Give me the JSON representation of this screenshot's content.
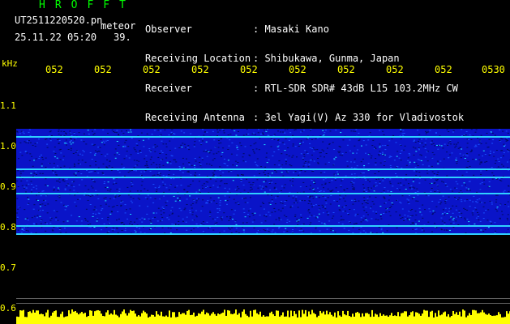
{
  "header": {
    "title": "HROFFT",
    "filename": "UT2511220520.pn",
    "meteor_label": "meteor",
    "datetime": "25.11.22 05:20",
    "count": "39.",
    "info": [
      {
        "label": "Observer",
        "value": ": Masaki Kano"
      },
      {
        "label": "Receiving Location",
        "value": ": Shibukawa, Gunma, Japan"
      },
      {
        "label": "Receiver",
        "value": ": RTL-SDR SDR# 43dB L15 103.2MHz CW"
      },
      {
        "label": "Receiving Antenna",
        "value": ": 3el Yagi(V) Az 330 for Vladivostok"
      }
    ]
  },
  "axis": {
    "unit": "kHz",
    "y_ticks": [
      "1.1",
      "1.0",
      "0.9",
      "0.8",
      "0.7",
      "0.6"
    ],
    "x_ticks": [
      "052",
      "052",
      "052",
      "052",
      "052",
      "052",
      "052",
      "052",
      "052",
      "0530"
    ]
  },
  "colors": {
    "label": "#ffff00",
    "title": "#00ff00",
    "text": "#ffffff",
    "background": "#000000",
    "spectrum_base": "#0a14c8"
  },
  "chart_data": {
    "type": "heatmap",
    "ylabel": "kHz",
    "ylim": [
      0.6,
      1.15
    ],
    "x_ticks": [
      "052",
      "052",
      "052",
      "052",
      "052",
      "052",
      "052",
      "052",
      "052",
      "0530"
    ],
    "band_range": [
      0.78,
      1.04
    ],
    "carrier_lines_khz": [
      1.02,
      0.94,
      0.92,
      0.88,
      0.8,
      0.78
    ]
  }
}
